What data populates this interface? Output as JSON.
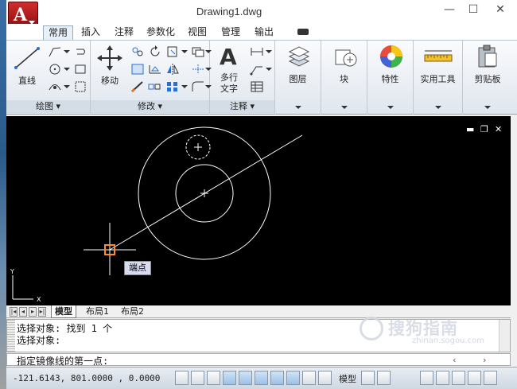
{
  "window": {
    "title": "Drawing1.dwg",
    "minimize": "—",
    "maximize": "☐",
    "close": "✕"
  },
  "app_button": {
    "letter": "A"
  },
  "tabs": [
    "常用",
    "插入",
    "注释",
    "参数化",
    "视图",
    "管理",
    "输出"
  ],
  "ribbon": {
    "draw_panel": {
      "label": "绘图 ▾",
      "line_label": "直线"
    },
    "modify_panel": {
      "label": "修改 ▾",
      "move_label": "移动"
    },
    "annotation_panel": {
      "label": "注释 ▾",
      "mtext_label": "多行\n文字",
      "mtext_line1": "多行",
      "mtext_line2": "文字"
    },
    "layer_panel": {
      "label": "图层"
    },
    "block_panel": {
      "label": "块"
    },
    "properties_panel": {
      "label": "特性"
    },
    "utilities_panel": {
      "label": "实用工具"
    },
    "clipboard_panel": {
      "label": "剪贴板"
    }
  },
  "viewport": {
    "controls": [
      "▬",
      "❐",
      "✕"
    ],
    "tooltip": "端点",
    "ucs_x": "X",
    "ucs_y": "Y"
  },
  "layout_tabs": [
    "模型",
    "布局1",
    "布局2"
  ],
  "command": {
    "history": [
      "选择对象: 找到 1 个",
      "选择对象:"
    ],
    "prompt": "指定镜像线的第一点:"
  },
  "status": {
    "coords": "-121.6143,  801.0000 , 0.0000",
    "model_label": "模型"
  },
  "watermark": {
    "text": "搜狗指南",
    "sub": "zhinan.sogou.com"
  },
  "colors": {
    "drawing_bg": "#000000",
    "geometry": "#ffffff",
    "cursor": "#ff8c28",
    "app_red": "#c62828"
  }
}
